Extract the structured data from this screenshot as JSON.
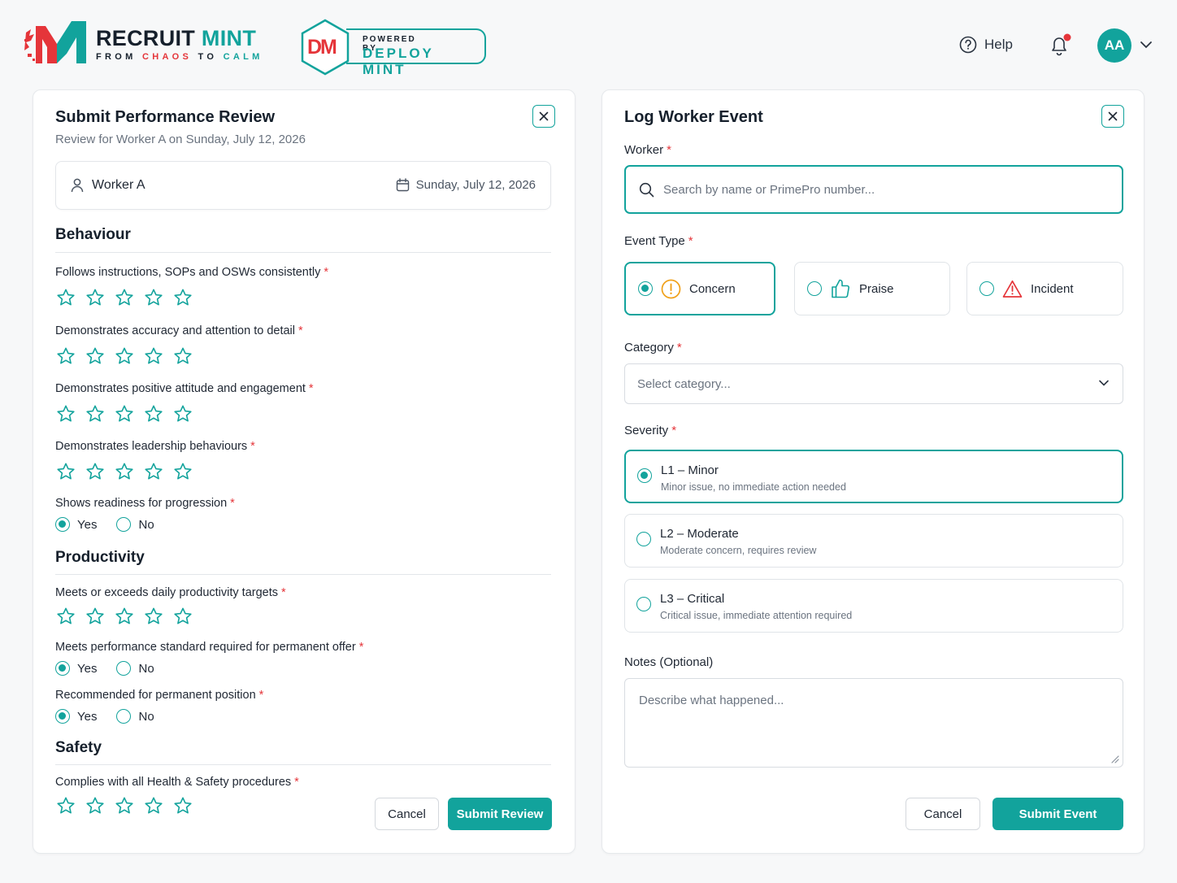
{
  "header": {
    "brand_name_1": "RECRUIT",
    "brand_name_2": "MINT",
    "tag_from": "FROM",
    "tag_chaos": "CHAOS",
    "tag_to": "TO",
    "tag_calm": "CALM",
    "badge_letters": "DM",
    "powered_by": "POWERED BY",
    "deploy_mint": "DEPLOY MINT",
    "help_label": "Help",
    "avatar_initials": "AA",
    "icons": [
      "help-circle-icon",
      "bell-icon",
      "chevron-down-icon"
    ]
  },
  "review": {
    "title": "Submit Performance Review",
    "subtitle": "Review for Worker A on Sunday, July 12, 2026",
    "worker": "Worker A",
    "date": "Sunday, July 12, 2026",
    "sections": {
      "behaviour": {
        "title": "Behaviour",
        "q1": "Follows instructions, SOPs and OSWs consistently",
        "q2": "Demonstrates accuracy and attention to detail",
        "q3": "Demonstrates positive attitude and engagement",
        "q4": "Demonstrates leadership behaviours",
        "q5": "Shows readiness for progression"
      },
      "productivity": {
        "title": "Productivity",
        "q1": "Meets or exceeds daily productivity targets",
        "q2": "Meets performance standard required for permanent offer",
        "q3": "Recommended for permanent position"
      },
      "safety": {
        "title": "Safety",
        "q1": "Complies with all Health & Safety procedures"
      }
    },
    "yes_label": "Yes",
    "no_label": "No",
    "required_mark": "*",
    "cancel_label": "Cancel",
    "submit_label": "Submit Review"
  },
  "event": {
    "title": "Log Worker Event",
    "worker_label": "Worker",
    "worker_placeholder": "Search by name or PrimePro number...",
    "event_type_label": "Event Type",
    "event_types": [
      {
        "label": "Concern",
        "selected": true
      },
      {
        "label": "Praise",
        "selected": false
      },
      {
        "label": "Incident",
        "selected": false
      }
    ],
    "category_label": "Category",
    "category_placeholder": "Select category...",
    "severity_label": "Severity",
    "severity": [
      {
        "title": "L1 – Minor",
        "desc": "Minor issue, no immediate action needed",
        "selected": true
      },
      {
        "title": "L2 – Moderate",
        "desc": "Moderate concern, requires review",
        "selected": false
      },
      {
        "title": "L3 – Critical",
        "desc": "Critical issue, immediate attention required",
        "selected": false
      }
    ],
    "notes_label": "Notes (Optional)",
    "notes_placeholder": "Describe what happened...",
    "cancel_label": "Cancel",
    "submit_label": "Submit Event"
  },
  "colors": {
    "accent": "#12a39c",
    "required": "#e5353a",
    "concern": "#f0a11b",
    "incident": "#e5353a"
  }
}
